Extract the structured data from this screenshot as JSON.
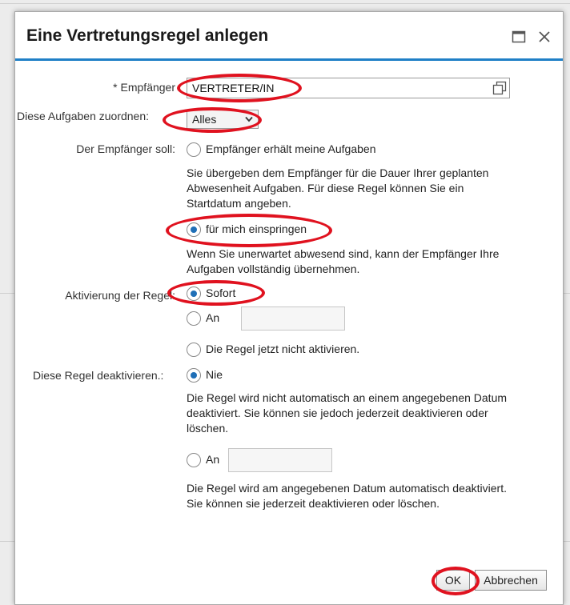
{
  "dialog": {
    "title": "Eine Vertretungsregel anlegen",
    "accent_color": "#1f7fc6",
    "annotation_color": "#e0121f"
  },
  "form": {
    "recipient": {
      "label": "Empfänger",
      "required_mark": "*",
      "value": "VERTRETER/IN",
      "icon": "value-help-icon"
    },
    "assign_tasks": {
      "label": "Diese Aufgaben zuordnen:",
      "selected": "Alles"
    },
    "recipient_should": {
      "label": "Der Empfänger soll:",
      "option1": {
        "label": "Empfänger erhält meine Aufgaben",
        "checked": false,
        "description": "Sie übergeben dem Empfänger für die Dauer Ihrer geplanten Abwesenheit Aufgaben. Für diese Regel können Sie ein Startdatum angeben."
      },
      "option2": {
        "label": "für mich einspringen",
        "checked": true,
        "description": "Wenn Sie unerwartet abwesend sind, kann der Empfänger Ihre Aufgaben vollständig übernehmen."
      }
    },
    "activation": {
      "label": "Aktivierung der Regel:",
      "option_now": "Sofort",
      "option_on": "An",
      "option_not": "Die Regel jetzt nicht aktivieren.",
      "selected": "Sofort"
    },
    "deactivation": {
      "label": "Diese Regel deaktivieren.:",
      "option_never": "Nie",
      "never_description": "Die Regel wird nicht automatisch an einem angegebenen Datum deaktiviert. Sie können sie jedoch jederzeit deaktivieren oder löschen.",
      "option_on": "An",
      "on_description": "Die Regel wird am angegebenen Datum automatisch deaktiviert. Sie können sie jederzeit deaktivieren oder löschen.",
      "selected": "Nie"
    }
  },
  "buttons": {
    "ok": "OK",
    "cancel": "Abbrechen"
  }
}
